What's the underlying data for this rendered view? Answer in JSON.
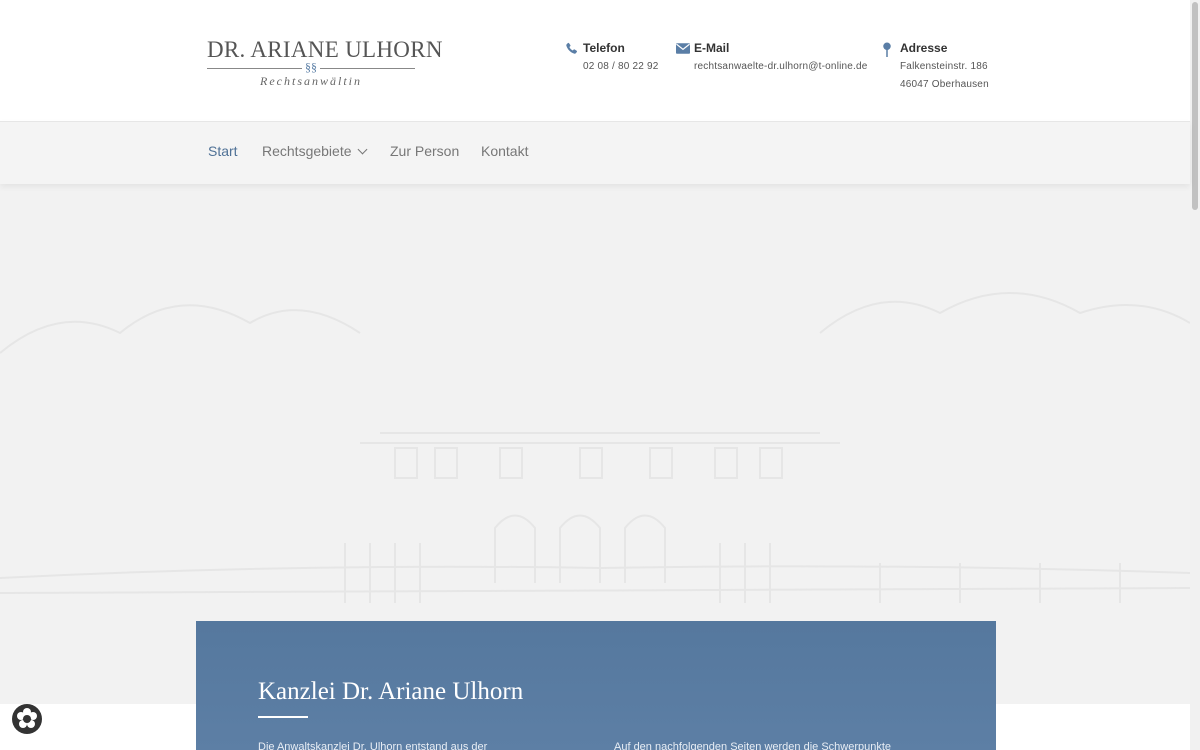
{
  "logo": {
    "name": "DR. ARIANE ULHORN",
    "symbol": "§§",
    "subtitle": "Rechtsanwältin"
  },
  "contact": {
    "phone": {
      "label": "Telefon",
      "value": "02 08 / 80 22 92",
      "icon": "phone-icon"
    },
    "email": {
      "label": "E-Mail",
      "value": "rechtsanwaelte-dr.ulhorn@t-online.de",
      "icon": "envelope-icon"
    },
    "address": {
      "label": "Adresse",
      "line1": "Falkensteinstr. 186",
      "line2": "46047 Oberhausen",
      "icon": "map-pin-icon"
    }
  },
  "nav": {
    "items": [
      {
        "label": "Start",
        "active": true
      },
      {
        "label": "Rechtsgebiete",
        "has_dropdown": true
      },
      {
        "label": "Zur Person"
      },
      {
        "label": "Kontakt"
      }
    ]
  },
  "intro": {
    "title": "Kanzlei Dr. Ariane Ulhorn",
    "col1_text": "Die Anwaltskanzlei Dr. Ulhorn entstand aus der",
    "col2_text": "Auf den nachfolgenden Seiten werden die Schwerpunkte"
  },
  "colors": {
    "accent": "#4f7196",
    "intro_bg": "#5a7ca2",
    "nav_bg": "#f4f4f4"
  },
  "cookie_icon": "cookie-settings-icon"
}
